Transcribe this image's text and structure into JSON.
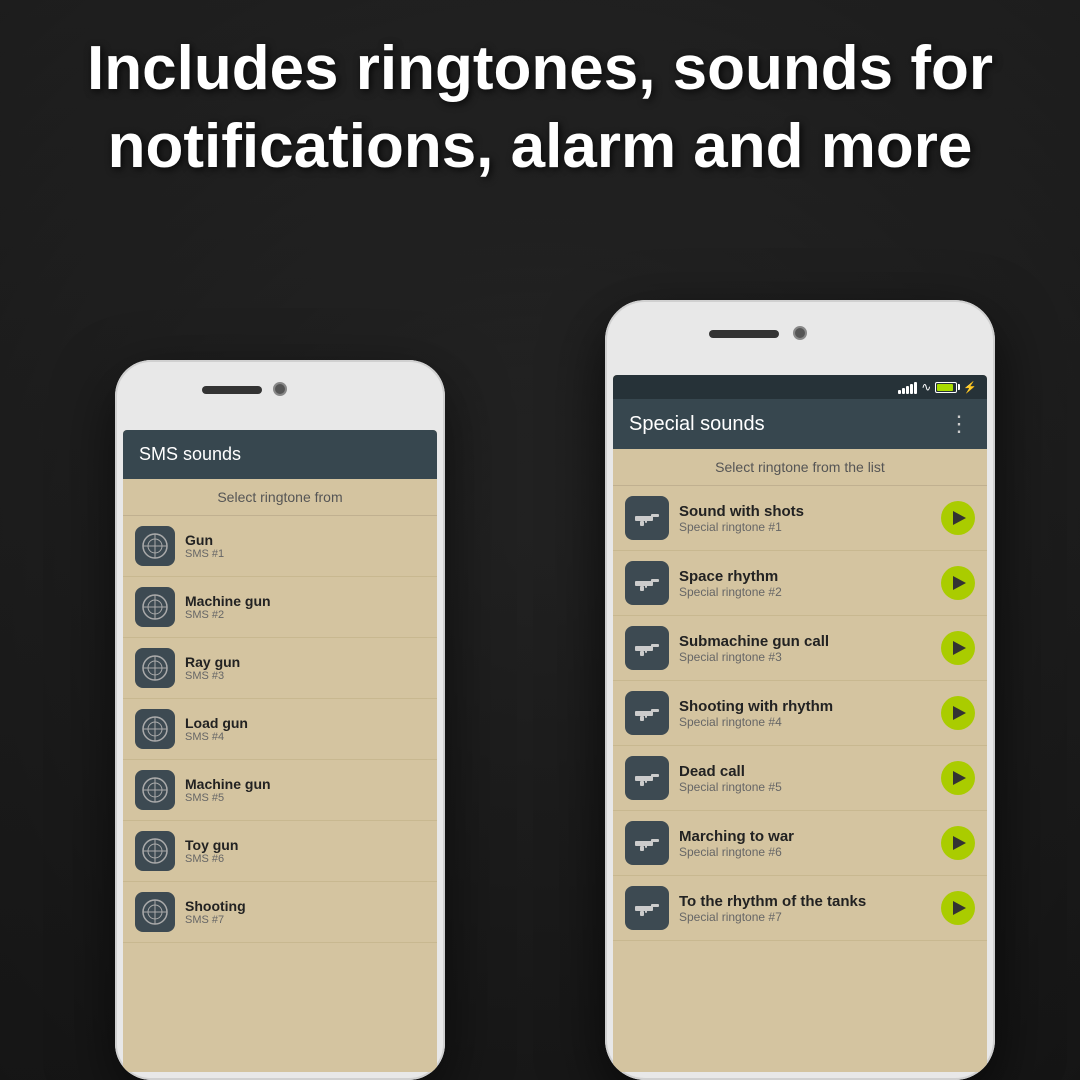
{
  "background": {
    "color": "#2a2a2a"
  },
  "header": {
    "title": "Includes ringtones, sounds for notifications, alarm and more"
  },
  "phone_left": {
    "app_title": "SMS sounds",
    "subtitle": "Select ringtone from",
    "items": [
      {
        "title": "Gun",
        "sub": "SMS #1"
      },
      {
        "title": "Machine gun",
        "sub": "SMS #2"
      },
      {
        "title": "Ray gun",
        "sub": "SMS #3"
      },
      {
        "title": "Load gun",
        "sub": "SMS #4"
      },
      {
        "title": "Machine gun",
        "sub": "SMS #5"
      },
      {
        "title": "Toy gun",
        "sub": "SMS #6"
      },
      {
        "title": "Shooting",
        "sub": "SMS #7"
      }
    ]
  },
  "phone_right": {
    "app_title": "Special sounds",
    "subtitle": "Select ringtone from the list",
    "menu_dots": "⋮",
    "items": [
      {
        "title": "Sound with shots",
        "sub": "Special ringtone #1"
      },
      {
        "title": "Space rhythm",
        "sub": "Special ringtone #2"
      },
      {
        "title": "Submachine gun call",
        "sub": "Special ringtone #3"
      },
      {
        "title": "Shooting with rhythm",
        "sub": "Special ringtone #4"
      },
      {
        "title": "Dead call",
        "sub": "Special ringtone #5"
      },
      {
        "title": "Marching to war",
        "sub": "Special ringtone #6"
      },
      {
        "title": "To the rhythm of the tanks",
        "sub": "Special ringtone #7"
      }
    ]
  }
}
